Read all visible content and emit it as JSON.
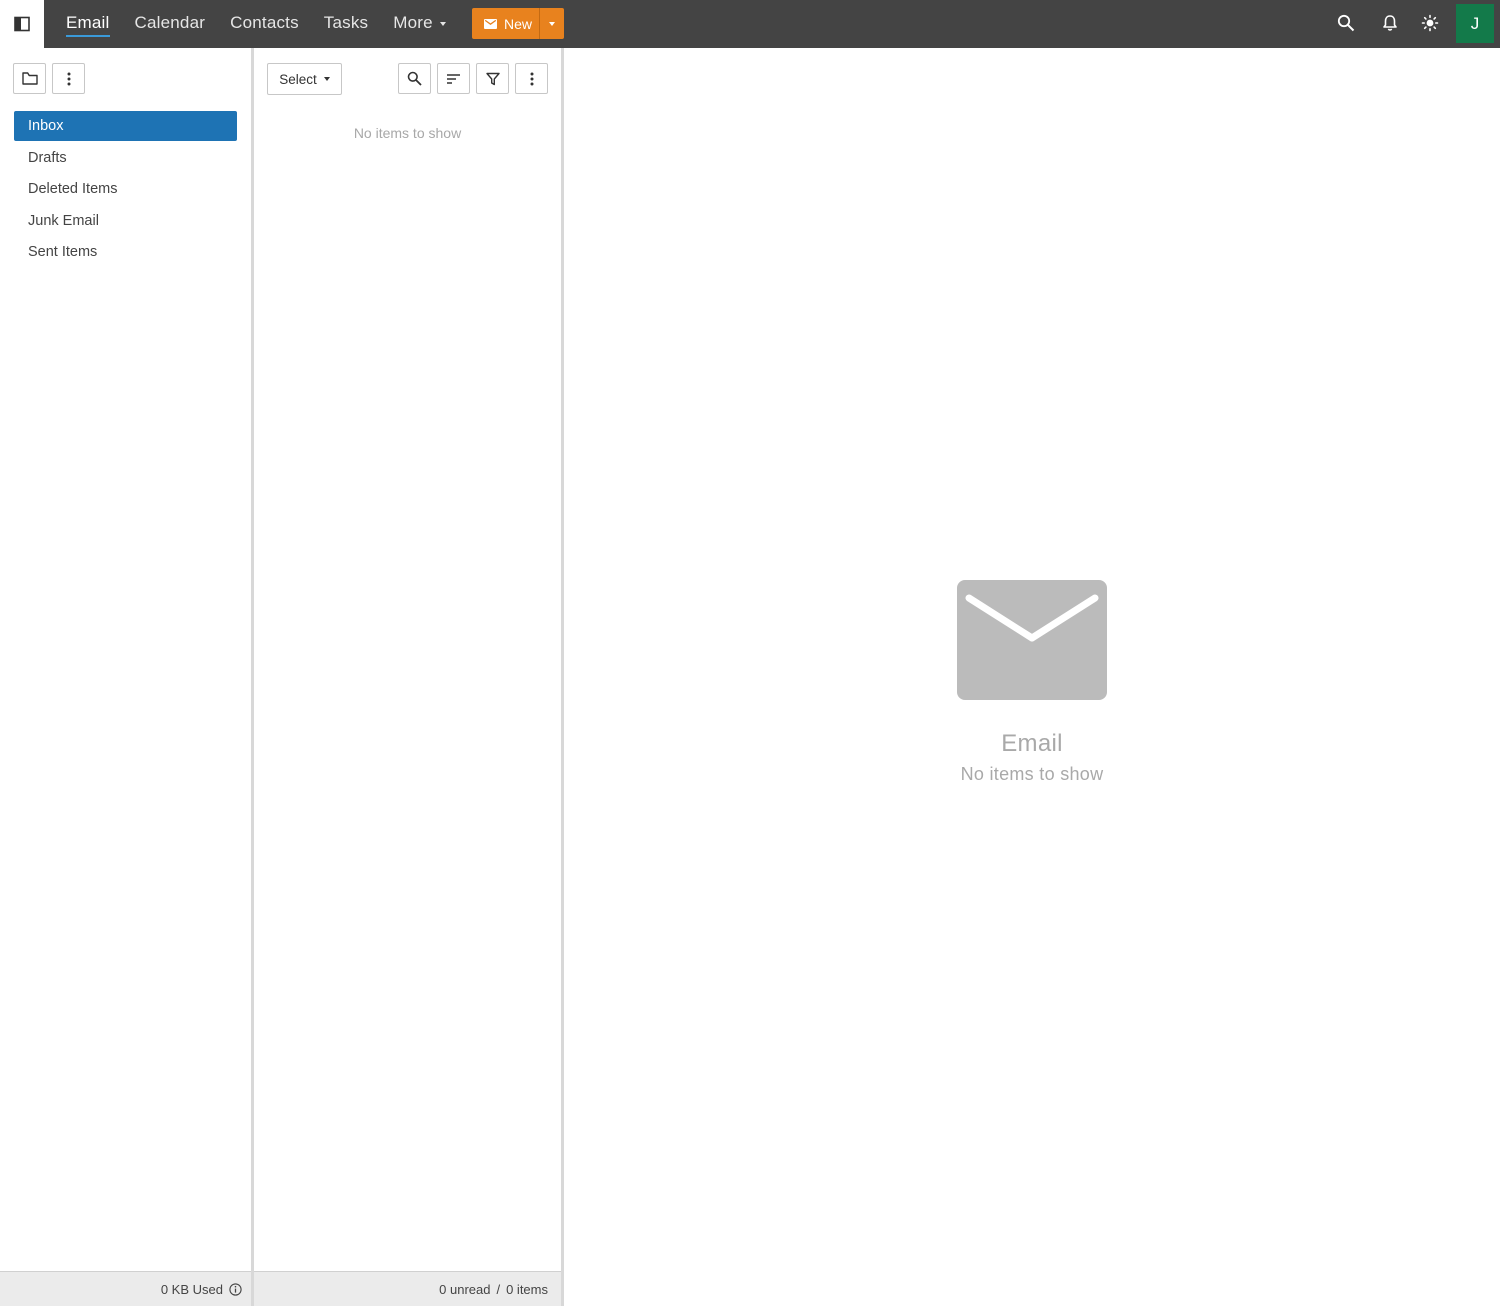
{
  "topbar": {
    "nav": [
      {
        "label": "Email",
        "active": true
      },
      {
        "label": "Calendar",
        "active": false
      },
      {
        "label": "Contacts",
        "active": false
      },
      {
        "label": "Tasks",
        "active": false
      },
      {
        "label": "More",
        "active": false
      }
    ],
    "new_button": {
      "label": "New",
      "color": "#e8821e"
    },
    "avatar": {
      "initial": "J",
      "color": "#137a4a"
    },
    "icons": [
      "sidebar-toggle-icon",
      "search-icon",
      "bell-icon",
      "sun-icon"
    ]
  },
  "folders": {
    "items": [
      {
        "label": "Inbox",
        "selected": true
      },
      {
        "label": "Drafts",
        "selected": false
      },
      {
        "label": "Deleted Items",
        "selected": false
      },
      {
        "label": "Junk Email",
        "selected": false
      },
      {
        "label": "Sent Items",
        "selected": false
      }
    ],
    "storage_used": "0 KB Used",
    "accent": "#1e73b4"
  },
  "message_list": {
    "select_label": "Select",
    "empty_text": "No items to show",
    "status": {
      "unread": "0 unread",
      "separator": "/",
      "items": "0 items"
    }
  },
  "reading_pane": {
    "empty_title": "Email",
    "empty_subtitle": "No items to show"
  }
}
